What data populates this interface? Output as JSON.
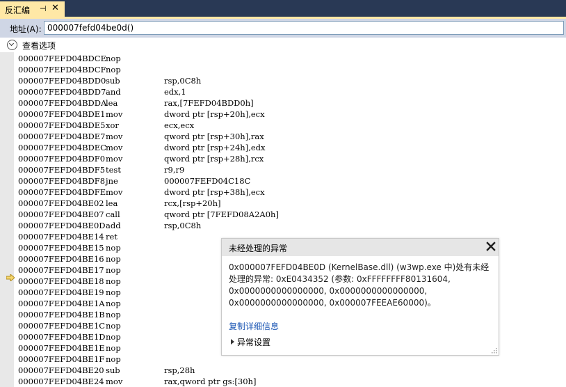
{
  "tab": {
    "title": "反汇编",
    "pin_glyph": "⊣",
    "close_glyph": "✕",
    "accent": "#ffe8a6",
    "strip_color": "#293955"
  },
  "address_bar": {
    "label": "地址(A):",
    "value": "000007fefd04be0d()"
  },
  "view_options": {
    "label": "查看选项"
  },
  "current_instruction_icon": "instruction-pointer-arrow-icon",
  "disassembly": [
    {
      "addr": "000007FEFD04BDCE",
      "mnemonic": "nop",
      "operands": ""
    },
    {
      "addr": "000007FEFD04BDCF",
      "mnemonic": "nop",
      "operands": ""
    },
    {
      "addr": "000007FEFD04BDD0",
      "mnemonic": "sub",
      "operands": "rsp,0C8h"
    },
    {
      "addr": "000007FEFD04BDD7",
      "mnemonic": "and",
      "operands": "edx,1"
    },
    {
      "addr": "000007FEFD04BDDA",
      "mnemonic": "lea",
      "operands": "rax,[7FEFD04BDD0h]"
    },
    {
      "addr": "000007FEFD04BDE1",
      "mnemonic": "mov",
      "operands": "dword ptr [rsp+20h],ecx"
    },
    {
      "addr": "000007FEFD04BDE5",
      "mnemonic": "xor",
      "operands": "ecx,ecx"
    },
    {
      "addr": "000007FEFD04BDE7",
      "mnemonic": "mov",
      "operands": "qword ptr [rsp+30h],rax"
    },
    {
      "addr": "000007FEFD04BDEC",
      "mnemonic": "mov",
      "operands": "dword ptr [rsp+24h],edx"
    },
    {
      "addr": "000007FEFD04BDF0",
      "mnemonic": "mov",
      "operands": "qword ptr [rsp+28h],rcx"
    },
    {
      "addr": "000007FEFD04BDF5",
      "mnemonic": "test",
      "operands": "r9,r9"
    },
    {
      "addr": "000007FEFD04BDF8",
      "mnemonic": "jne",
      "operands": "000007FEFD04C18C"
    },
    {
      "addr": "000007FEFD04BDFE",
      "mnemonic": "mov",
      "operands": "dword ptr [rsp+38h],ecx"
    },
    {
      "addr": "000007FEFD04BE02",
      "mnemonic": "lea",
      "operands": "rcx,[rsp+20h]"
    },
    {
      "addr": "000007FEFD04BE07",
      "mnemonic": "call",
      "operands": "qword ptr [7FEFD08A2A0h]"
    },
    {
      "addr": "000007FEFD04BE0D",
      "mnemonic": "add",
      "operands": "rsp,0C8h",
      "current": true
    },
    {
      "addr": "000007FEFD04BE14",
      "mnemonic": "ret",
      "operands": ""
    },
    {
      "addr": "000007FEFD04BE15",
      "mnemonic": "nop",
      "operands": ""
    },
    {
      "addr": "000007FEFD04BE16",
      "mnemonic": "nop",
      "operands": ""
    },
    {
      "addr": "000007FEFD04BE17",
      "mnemonic": "nop",
      "operands": ""
    },
    {
      "addr": "000007FEFD04BE18",
      "mnemonic": "nop",
      "operands": ""
    },
    {
      "addr": "000007FEFD04BE19",
      "mnemonic": "nop",
      "operands": ""
    },
    {
      "addr": "000007FEFD04BE1A",
      "mnemonic": "nop",
      "operands": ""
    },
    {
      "addr": "000007FEFD04BE1B",
      "mnemonic": "nop",
      "operands": ""
    },
    {
      "addr": "000007FEFD04BE1C",
      "mnemonic": "nop",
      "operands": ""
    },
    {
      "addr": "000007FEFD04BE1D",
      "mnemonic": "nop",
      "operands": ""
    },
    {
      "addr": "000007FEFD04BE1E",
      "mnemonic": "nop",
      "operands": ""
    },
    {
      "addr": "000007FEFD04BE1F",
      "mnemonic": "nop",
      "operands": ""
    },
    {
      "addr": "000007FEFD04BE20",
      "mnemonic": "sub",
      "operands": "rsp,28h"
    },
    {
      "addr": "000007FEFD04BE24",
      "mnemonic": "mov",
      "operands": "rax,qword ptr gs:[30h]"
    }
  ],
  "exception_popup": {
    "title": "未经处理的异常",
    "message": "0x000007FEFD04BE0D (KernelBase.dll) (w3wp.exe 中)处有未经处理的异常: 0xE0434352 (参数: 0xFFFFFFFF80131604, 0x0000000000000000, 0x0000000000000000, 0x0000000000000000, 0x000007FEEAE60000)。",
    "copy_details_link": "复制详细信息",
    "exception_settings": "异常设置",
    "link_color": "#1e58b5"
  }
}
